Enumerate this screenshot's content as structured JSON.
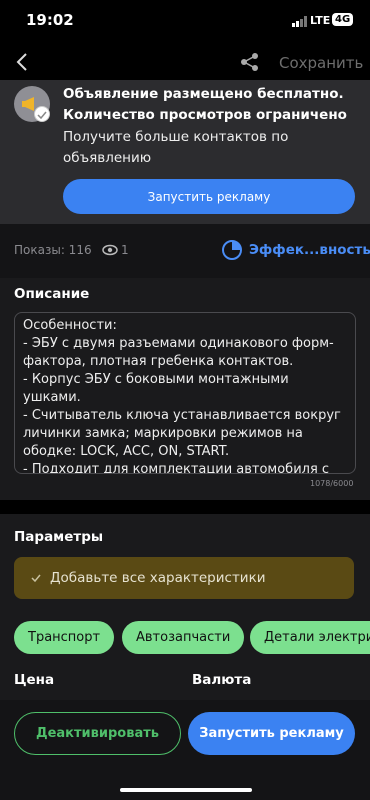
{
  "status_bar": {
    "time": "19:02",
    "network": "LTE",
    "badge": "4G"
  },
  "header": {
    "save_label": "Сохранить"
  },
  "promo": {
    "title": "Объявление размещено бесплатно. Количество просмотров ограничено",
    "description": "Получите больше контактов по объявлению",
    "button_label": "Запустить рекламу"
  },
  "stats": {
    "views_label": "Показы: 116",
    "favorites_count": "1",
    "efficiency_label": "Эффек...вность"
  },
  "description": {
    "title": "Описание",
    "text": "Особенности:\n- ЭБУ с двумя разъемами одинакового форм-фактора, плотная гребенка контактов.\n- Корпус ЭБУ с боковыми монтажными ушками.\n- Считыватель ключа устанавливается вокруг личинки замка; маркировки режимов на ободке: LOCK, ACC, ON, START.\n- Подходит для комплектации автомобиля с иммобилайзером, может использоваться как",
    "counter": "1078/6000"
  },
  "params": {
    "title": "Параметры",
    "warning": "Добавьте все характеристики",
    "chips": [
      "Транспорт",
      "Автозапчасти",
      "Детали электри"
    ]
  },
  "fields": {
    "price_label": "Цена",
    "currency_label": "Валюта"
  },
  "bottom": {
    "deactivate_label": "Деактивировать",
    "promote_label": "Запустить рекламу"
  },
  "colors": {
    "accent": "#3b82f2",
    "chip": "#7ce08f",
    "warning_bg": "#5a4a14",
    "deactivate": "#4fbf6a"
  }
}
